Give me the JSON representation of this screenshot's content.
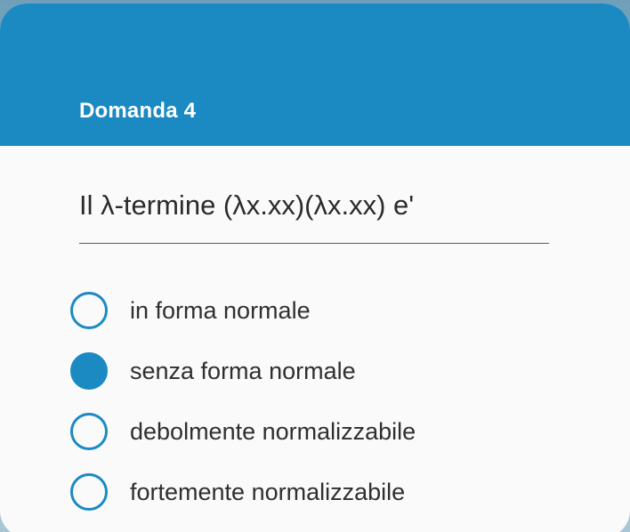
{
  "quiz": {
    "title": "Domanda 4",
    "question": "Il λ-termine (λx.xx)(λx.xx) e'",
    "options": [
      {
        "label": "in forma normale",
        "selected": false
      },
      {
        "label": "senza forma normale",
        "selected": true
      },
      {
        "label": "debolmente normalizzabile",
        "selected": false
      },
      {
        "label": "fortemente normalizzabile",
        "selected": false
      }
    ]
  },
  "colors": {
    "accent": "#1b8ac2",
    "card_background": "#fafafa",
    "text": "#2f2f2f"
  }
}
